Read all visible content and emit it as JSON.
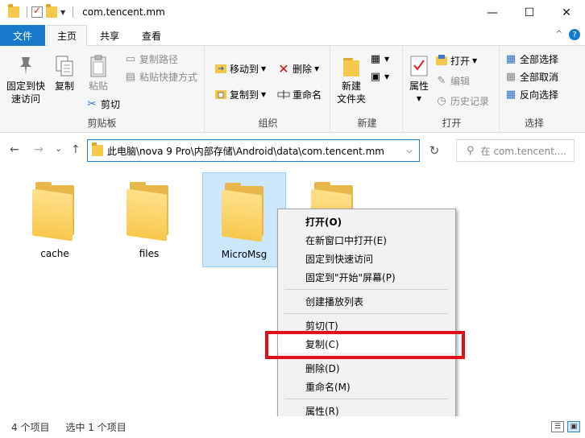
{
  "window": {
    "title": "com.tencent.mm",
    "controls": {
      "minimize": "—",
      "maximize": "☐",
      "close": "✕"
    }
  },
  "ribbon_tabs": {
    "file": "文件",
    "home": "主页",
    "share": "共享",
    "view": "查看",
    "collapse": "^",
    "help": "?"
  },
  "ribbon": {
    "clipboard": {
      "label": "剪贴板",
      "pin_line1": "固定到快",
      "pin_line2": "速访问",
      "copy": "复制",
      "paste": "粘贴",
      "copy_path": "复制路径",
      "paste_shortcut": "粘贴快捷方式",
      "cut": "剪切"
    },
    "organize": {
      "label": "组织",
      "move_to": "移动到",
      "copy_to": "复制到",
      "delete": "删除",
      "rename": "重命名"
    },
    "new": {
      "label": "新建",
      "new_folder_line1": "新建",
      "new_folder_line2": "文件夹"
    },
    "open": {
      "label": "打开",
      "properties": "属性",
      "open": "打开",
      "edit": "编辑",
      "history": "历史记录"
    },
    "select": {
      "label": "选择",
      "select_all": "全部选择",
      "select_none": "全部取消",
      "invert": "反向选择"
    }
  },
  "nav": {
    "back": "←",
    "forward": "→",
    "recent": "⌄",
    "up": "↑",
    "address": "此电脑\\nova 9 Pro\\内部存储\\Android\\data\\com.tencent.mm",
    "refresh": "↻",
    "search_placeholder": "在 com.tencent...."
  },
  "items": [
    {
      "name": "cache",
      "selected": false
    },
    {
      "name": "files",
      "selected": false
    },
    {
      "name": "MicroMsg",
      "selected": true
    },
    {
      "name": "",
      "selected": false
    }
  ],
  "context_menu": {
    "open": "打开(O)",
    "open_new_window": "在新窗口中打开(E)",
    "pin_quick_access": "固定到快速访问",
    "pin_start": "固定到\"开始\"屏幕(P)",
    "create_playlist": "创建播放列表",
    "cut": "剪切(T)",
    "copy": "复制(C)",
    "delete": "删除(D)",
    "rename": "重命名(M)",
    "properties": "属性(R)"
  },
  "status": {
    "count": "4 个项目",
    "selected": "选中 1 个项目"
  },
  "colors": {
    "accent": "#1979ca",
    "highlight_box": "#e0101a",
    "selection": "#cce8ff",
    "folder": "#f7c84c"
  }
}
